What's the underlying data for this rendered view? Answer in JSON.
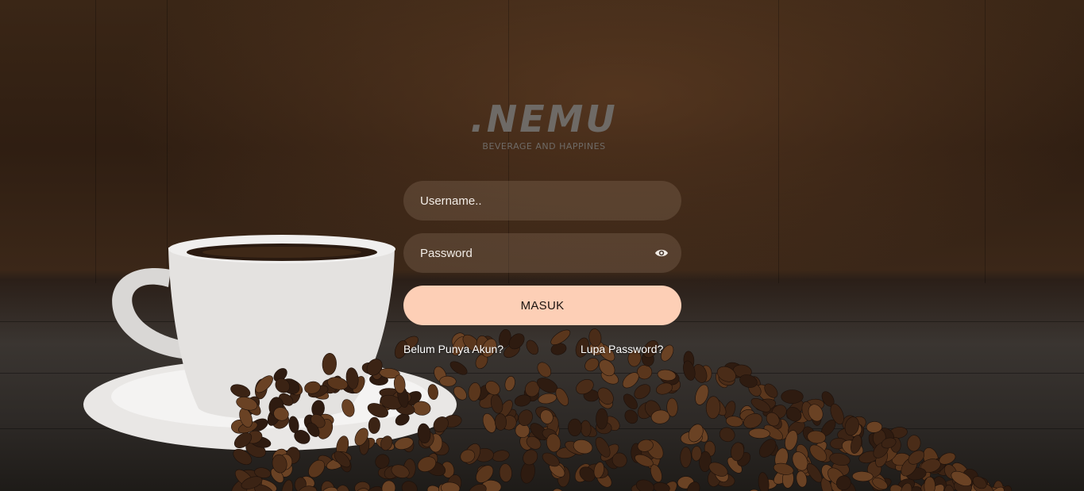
{
  "brand": {
    "name": ".NEMU",
    "tagline": "BEVERAGE AND HAPPINES"
  },
  "login_form": {
    "username_placeholder": "Username..",
    "password_placeholder": "Password",
    "submit_label": "MASUK",
    "register_link": "Belum Punya Akun?",
    "forgot_link": "Lupa Password?"
  },
  "icons": {
    "password_toggle": "eye-icon"
  },
  "colors": {
    "accent_button": "#fdcfb6",
    "logo_text": "#6e6a66"
  }
}
